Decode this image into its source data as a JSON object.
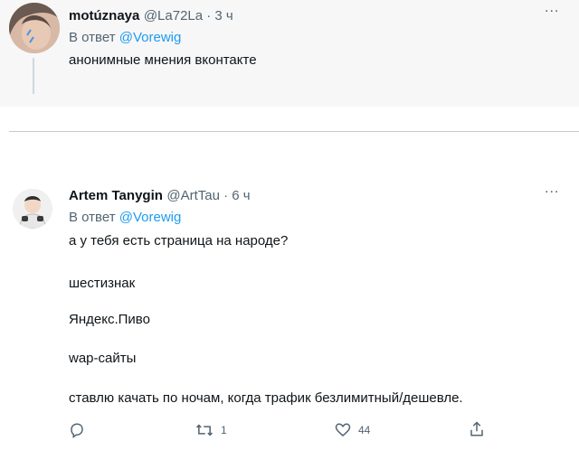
{
  "tweet1": {
    "name": "motúznaya",
    "handle_time": "@La72La · 3 ч",
    "reply_prefix": "В ответ",
    "reply_to": "@Vorewig",
    "text": "анонимные мнения вконтакте",
    "more": "..."
  },
  "tweet2": {
    "name": "Artem Tanygin",
    "handle_time": "@ArtTau · 6 ч",
    "reply_prefix": "В ответ",
    "reply_to": "@Vorewig",
    "lines": [
      "а у тебя есть страница на народе?",
      "шестизнак",
      "Яндекс.Пиво",
      "wap-сайты",
      "ставлю качать по ночам, когда трафик безлимитный/дешевле."
    ],
    "more": "...",
    "actions": {
      "reply_count": "",
      "retweet_count": "1",
      "like_count": "44"
    }
  },
  "icons": [
    "reply-icon",
    "retweet-icon",
    "like-icon",
    "share-icon",
    "more-icon"
  ]
}
